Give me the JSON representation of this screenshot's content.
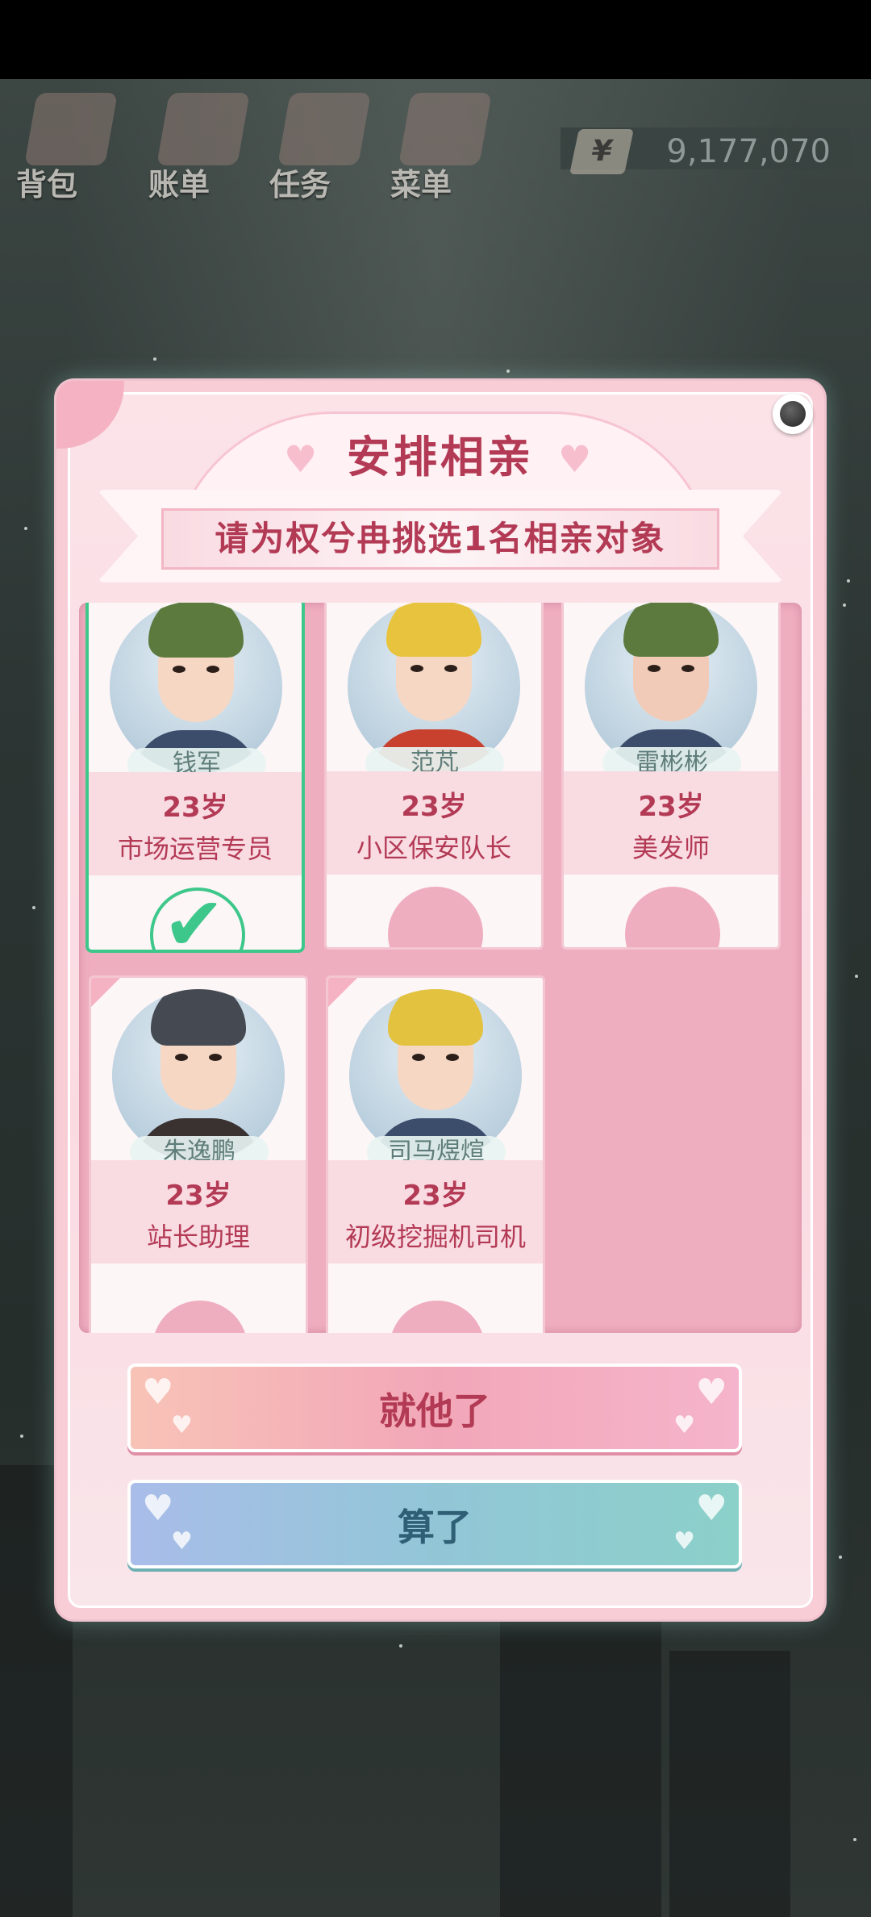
{
  "top_menu": {
    "items": [
      {
        "label": "背包",
        "icon": "backpack-icon"
      },
      {
        "label": "账单",
        "icon": "bill-icon"
      },
      {
        "label": "任务",
        "icon": "task-icon"
      },
      {
        "label": "菜单",
        "icon": "menu-icon"
      }
    ],
    "currency_symbol": "¥",
    "money": "9,177,070"
  },
  "dialog": {
    "title": "安排相亲",
    "subtitle": "请为权兮冉挑选1名相亲对象",
    "candidates": [
      {
        "name": "钱军",
        "age": "23岁",
        "job": "市场运营专员",
        "selected": true,
        "hair": "#5d7a3e",
        "shirt": "#3b4d6b"
      },
      {
        "name": "范芃",
        "age": "23岁",
        "job": "小区保安队长",
        "selected": false,
        "hair": "#e8c33e",
        "shirt": "#c8412f"
      },
      {
        "name": "雷彬彬",
        "age": "23岁",
        "job": "美发师",
        "selected": false,
        "hair": "#5d7a3e",
        "shirt": "#3b4d6b"
      },
      {
        "name": "朱逸鹏",
        "age": "23岁",
        "job": "站长助理",
        "selected": false,
        "hair": "#454a52",
        "shirt": "#3a3131"
      },
      {
        "name": "司马煜煊",
        "age": "23岁",
        "job": "初级挖掘机司机",
        "selected": false,
        "hair": "#e3c240",
        "shirt": "#3b4d6b"
      }
    ],
    "confirm_label": "就他了",
    "cancel_label": "算了"
  },
  "colors": {
    "accent": "#b33a55",
    "selected": "#3ec78b",
    "dialog_bg": "#f8cdd6"
  }
}
